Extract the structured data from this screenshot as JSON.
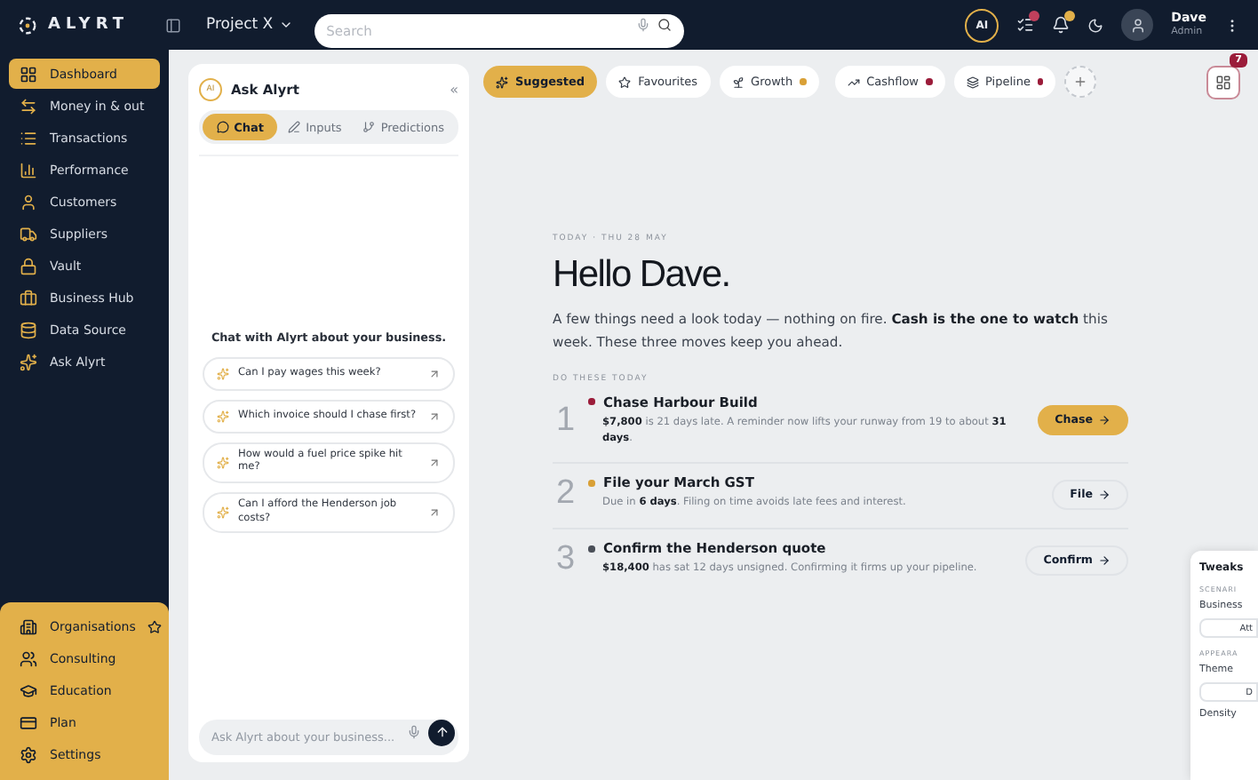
{
  "brand": {
    "name": "ALYRT"
  },
  "topbar": {
    "project": "Project X",
    "search": {
      "placeholder": "Search"
    },
    "ai_badge": "AI",
    "user": {
      "name": "Dave",
      "role": "Admin"
    }
  },
  "sidebar": {
    "items": [
      {
        "label": "Dashboard",
        "selected": true
      },
      {
        "label": "Money in & out",
        "selected": false
      },
      {
        "label": "Transactions",
        "selected": false
      },
      {
        "label": "Performance",
        "selected": false
      },
      {
        "label": "Customers",
        "selected": false
      },
      {
        "label": "Suppliers",
        "selected": false
      },
      {
        "label": "Vault",
        "selected": false
      },
      {
        "label": "Business Hub",
        "selected": false
      },
      {
        "label": "Data Source",
        "selected": false
      },
      {
        "label": "Ask Alyrt",
        "selected": false
      }
    ],
    "bottom_items": [
      {
        "label": "Organisations",
        "starred": true
      },
      {
        "label": "Consulting",
        "starred": false
      },
      {
        "label": "Education",
        "starred": false
      },
      {
        "label": "Plan",
        "starred": false
      },
      {
        "label": "Settings",
        "starred": false
      }
    ]
  },
  "chat": {
    "avatar": "AI",
    "title": "Ask Alyrt",
    "collapse": "«",
    "tabs": [
      {
        "label": "Chat",
        "selected": true
      },
      {
        "label": "Inputs",
        "selected": false
      },
      {
        "label": "Predictions",
        "selected": false
      }
    ],
    "prompt": "Chat with Alyrt about your business.",
    "suggestions": [
      "Can I pay wages this week?",
      "Which invoice should I chase first?",
      "How would a fuel price spike hit me?",
      "Can I afford the Henderson job costs?"
    ],
    "input": {
      "placeholder": "Ask Alyrt about your business..."
    }
  },
  "filters": [
    {
      "label": "Suggested",
      "selected": true
    },
    {
      "label": "Favourites",
      "selected": false
    },
    {
      "label": "Growth",
      "selected": false,
      "color": "#d9a036"
    },
    {
      "label": "Cashflow",
      "selected": false,
      "color": "#9b1c3a"
    },
    {
      "label": "Pipeline",
      "selected": false,
      "color": "#9b1c3a"
    }
  ],
  "widgets_badge": "7",
  "hero": {
    "date": "TODAY · THU 28 MAY",
    "greeting": "Hello Dave.",
    "summary": "A few things need a look today — nothing on fire. **Cash is the one to watch** this week. These three moves keep you ahead.",
    "section": "DO THESE TODAY"
  },
  "tasks": [
    {
      "number": "1",
      "color": "#9b1c3a",
      "title": "Chase Harbour Build",
      "text": "**$7,800** is 21 days late. A reminder now lifts your runway from 19 to about **31 days**.",
      "action": "Chase",
      "kind": "primary"
    },
    {
      "number": "2",
      "color": "#d9a036",
      "title": "File your March GST",
      "text": "Due in **6 days**. Filing on time avoids late fees and interest.",
      "action": "File",
      "kind": "secondary"
    },
    {
      "number": "3",
      "color": "#4a4f58",
      "title": "Confirm the Henderson quote",
      "text": "**$18,400** has sat 12 days unsigned. Confirming it firms up your pipeline.",
      "action": "Confirm",
      "kind": "secondary"
    }
  ],
  "tweaks": {
    "title": "Tweaks",
    "section_1": "SCENARI",
    "field_1": "Business",
    "value_1": "Att",
    "section_2": "APPEARA",
    "field_2": "Theme",
    "value_2": "D",
    "field_3": "Density"
  }
}
